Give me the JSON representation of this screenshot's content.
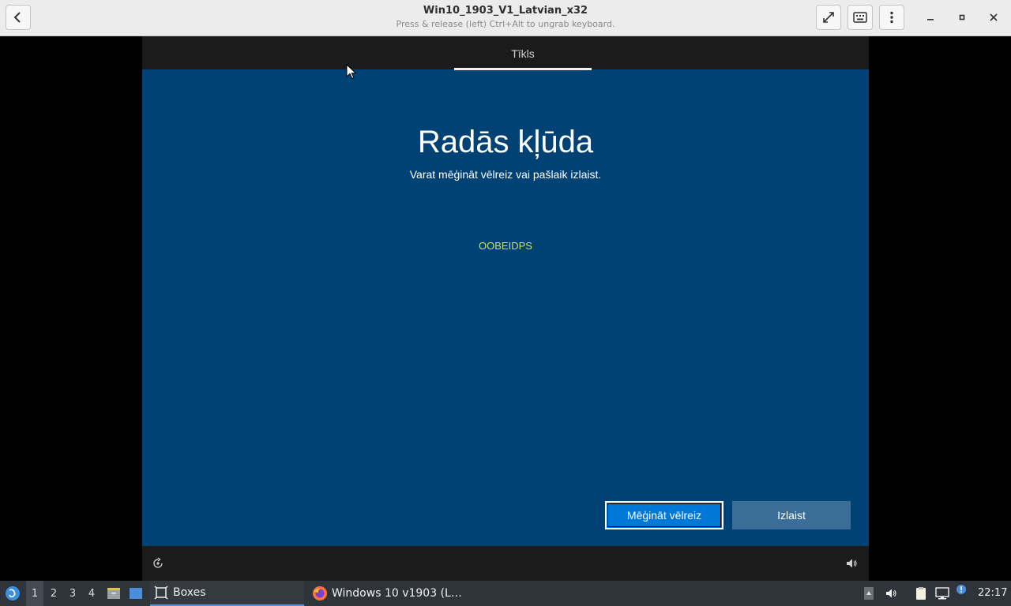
{
  "window": {
    "title": "Win10_1903_V1_Latvian_x32",
    "subtitle": "Press & release (left) Ctrl+Alt to ungrab keyboard."
  },
  "header_icons": [
    "back-arrow-icon",
    "fullscreen-icon",
    "keyboard-icon",
    "kebab-menu-icon",
    "minimize-icon",
    "maximize-icon",
    "close-icon"
  ],
  "vm": {
    "top_tab": "Tīkls",
    "heading": "Radās kļūda",
    "subheading": "Varat mēģināt vēlreiz vai pašlaik izlaist.",
    "error_code": "OOBEIDPS",
    "buttons": {
      "retry": "Mēģināt vēlreiz",
      "skip": "Izlaist"
    },
    "colors": {
      "background": "#004274",
      "primary_button": "#0078d7",
      "secondary_button": "#3a6e98",
      "error_code": "#c6e34a"
    }
  },
  "taskbar": {
    "workspaces": [
      "1",
      "2",
      "3",
      "4"
    ],
    "active_workspace": "1",
    "tasks": [
      {
        "label": "Boxes",
        "icon": "boxes-icon"
      },
      {
        "label": "Windows 10 v1903 (L…",
        "icon": "firefox-icon"
      }
    ],
    "clock": "22:17"
  }
}
